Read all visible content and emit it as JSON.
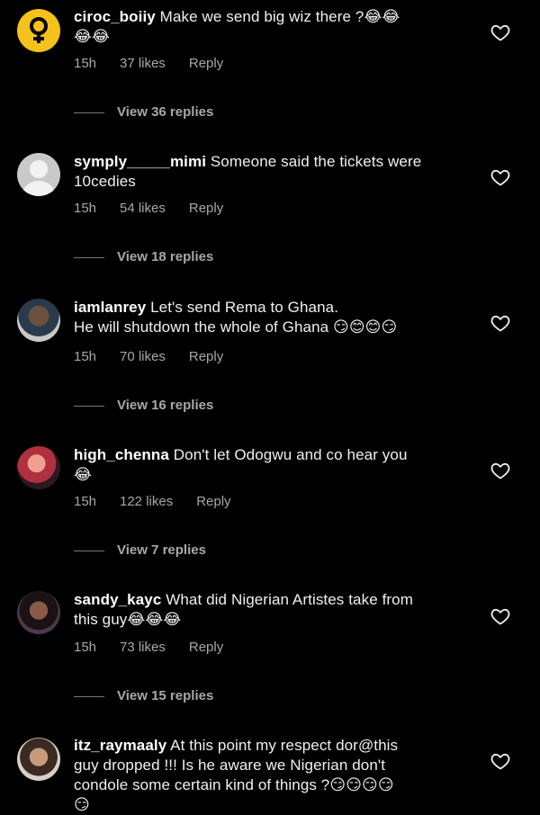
{
  "comments": [
    {
      "username": "ciroc_boiiy",
      "text": " Make we send big wiz there ?",
      "emoji_tail": "😂😂",
      "line2": "😂😂",
      "time": "15h",
      "likes": "37 likes",
      "reply": "Reply",
      "view_replies": "View 36 replies",
      "avatar": "female-symbol-icon"
    },
    {
      "username": "symply_____mimi",
      "text": " Someone said the tickets were",
      "emoji_tail": "",
      "line2": "10cedies",
      "time": "15h",
      "likes": "54 likes",
      "reply": "Reply",
      "view_replies": "View 18 replies",
      "avatar": "default-avatar-icon"
    },
    {
      "username": "iamlanrey",
      "text": " Let's send Rema to Ghana.",
      "emoji_tail": "",
      "line2": "He will shutdown the whole of Ghana 😏😊😊😏",
      "time": "15h",
      "likes": "70 likes",
      "reply": "Reply",
      "view_replies": "View 16 replies",
      "avatar": "profile-photo"
    },
    {
      "username": "high_chenna",
      "text": " Don't let Odogwu and co hear you",
      "emoji_tail": "",
      "line2": "😂",
      "time": "15h",
      "likes": "122 likes",
      "reply": "Reply",
      "view_replies": "View 7 replies",
      "avatar": "profile-photo"
    },
    {
      "username": "sandy_kayc",
      "text": " What did Nigerian Artistes take from",
      "emoji_tail": "",
      "line2": "this guy😂😂😂",
      "time": "15h",
      "likes": "73 likes",
      "reply": "Reply",
      "view_replies": "View 15 replies",
      "avatar": "profile-photo"
    },
    {
      "username": "itz_raymaaly",
      "text": " At this point my respect dor@this",
      "emoji_tail": "",
      "line2": "guy dropped !!! Is he aware we Nigerian don't",
      "line3": "condole some certain kind of things ?😏😏😏😏",
      "line4": "😏",
      "avatar": "profile-photo"
    }
  ],
  "colors": {
    "background": "#000000",
    "text": "#f0f0f0",
    "muted": "#a8a8a8",
    "avatar_yellow": "#f4c21b"
  }
}
